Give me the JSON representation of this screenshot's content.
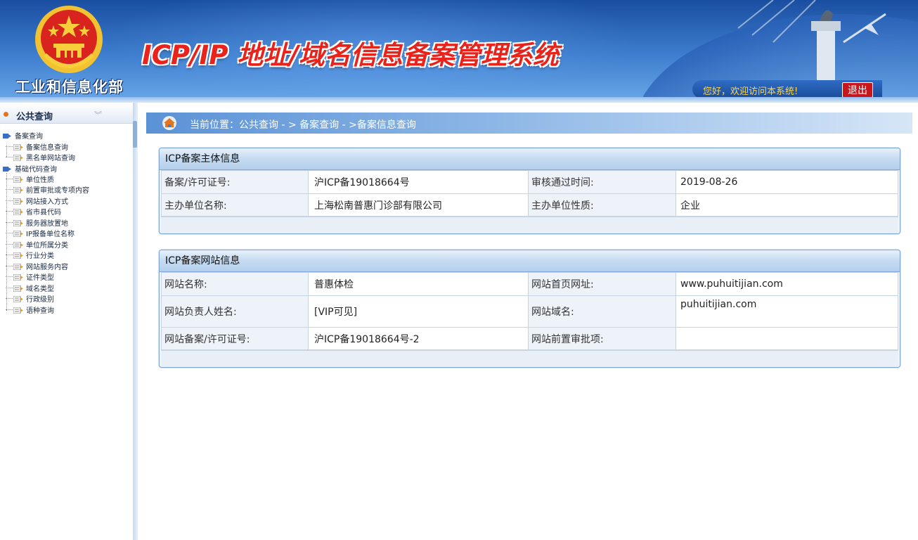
{
  "header": {
    "ministry_name": "工业和信息化部",
    "system_title": "ICP/IP 地址/域名信息备案管理系统",
    "welcome": "您好，欢迎访问本系统!",
    "logout_label": "退出"
  },
  "sidebar": {
    "title": "公共查询",
    "collapse_icon": "double-chevron-down",
    "groups": [
      {
        "label": "备案查询",
        "items": [
          {
            "label": "备案信息查询"
          },
          {
            "label": "黑名单网站查询"
          }
        ]
      },
      {
        "label": "基础代码查询",
        "items": [
          {
            "label": "单位性质"
          },
          {
            "label": "前置审批或专项内容"
          },
          {
            "label": "网站接入方式"
          },
          {
            "label": "省市县代码"
          },
          {
            "label": "服务器放置地"
          },
          {
            "label": "IP报备单位名称"
          },
          {
            "label": "单位所属分类"
          },
          {
            "label": "行业分类"
          },
          {
            "label": "网站服务内容"
          },
          {
            "label": "证件类型"
          },
          {
            "label": "域名类型"
          },
          {
            "label": "行政级别"
          },
          {
            "label": "语种查询"
          }
        ]
      }
    ]
  },
  "breadcrumb": {
    "text": "当前位置：公共查询 - > 备案查询 - >备案信息查询"
  },
  "subject_panel": {
    "title": "ICP备案主体信息",
    "rows": [
      {
        "l1": "备案/许可证号:",
        "v1": "沪ICP备19018664号",
        "l2": "审核通过时间:",
        "v2": "2019-08-26"
      },
      {
        "l1": "主办单位名称:",
        "v1": "上海松南普惠门诊部有限公司",
        "l2": "主办单位性质:",
        "v2": "企业"
      }
    ]
  },
  "website_panel": {
    "title": "ICP备案网站信息",
    "rows": [
      {
        "l1": "网站名称:",
        "v1": "普惠体检",
        "l2": "网站首页网址:",
        "v2": "www.puhuitijian.com"
      },
      {
        "l1": "网站负责人姓名:",
        "v1": "[VIP可见]",
        "l2": "网站域名:",
        "v2": "puhuitijian.com"
      },
      {
        "l1": "网站备案/许可证号:",
        "v1": "沪ICP备19018664号-2",
        "l2": "网站前置审批项:",
        "v2": ""
      }
    ]
  },
  "colors": {
    "header_blue": "#1a4ea0",
    "title_red": "#e8231c",
    "link_blue": "#2a6ab5",
    "welcome_yellow": "#ffd84a"
  }
}
